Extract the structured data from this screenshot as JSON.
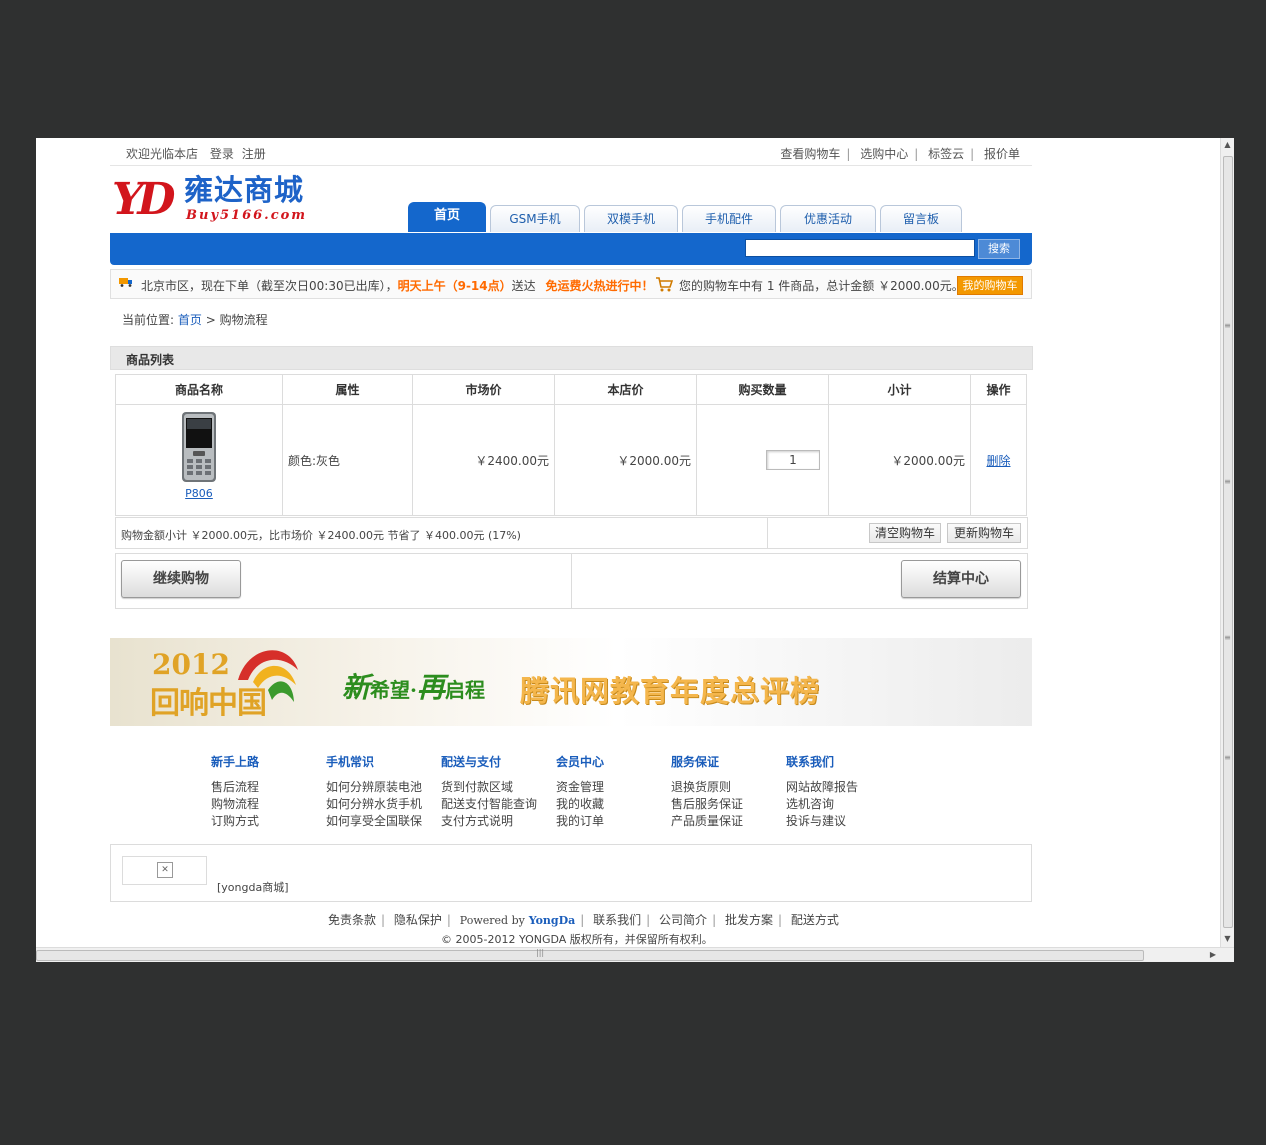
{
  "topbar": {
    "welcome": "欢迎光临本店",
    "login": "登录",
    "register": "注册",
    "links": [
      "查看购物车",
      "选购中心",
      "标签云",
      "报价单"
    ]
  },
  "logo": {
    "cn": "雍达商城",
    "mark": "YD",
    "en": "Buy5166.com"
  },
  "nav": {
    "tabs": [
      "首页",
      "GSM手机",
      "双模手机",
      "手机配件",
      "优惠活动",
      "留言板"
    ],
    "active": "首页"
  },
  "search": {
    "button": "搜索",
    "placeholder": ""
  },
  "info": {
    "delivery_prefix": "北京市区，现在下单（截至次日00:30已出库），",
    "delivery_highlight": "明天上午（9-14点）",
    "delivery_suffix": "送达",
    "promo": "免运费火热进行中！",
    "cart_summary": "您的购物车中有 1 件商品，总计金额 ￥2000.00元。",
    "my_cart": "我的购物车"
  },
  "breadcrumb": {
    "label": "当前位置:",
    "home": "首页",
    "arrow": ">",
    "current": "购物流程"
  },
  "section_title": "商品列表",
  "cart_table": {
    "headers": [
      "商品名称",
      "属性",
      "市场价",
      "本店价",
      "购买数量",
      "小计",
      "操作"
    ],
    "rows": [
      {
        "product": "P806",
        "attribute": "颜色:灰色",
        "market_price": "￥2400.00元",
        "shop_price": "￥2000.00元",
        "quantity": "1",
        "subtotal": "￥2000.00元",
        "action": "删除"
      }
    ]
  },
  "summary": {
    "text": "购物金额小计 ￥2000.00元，比市场价 ￥2400.00元 节省了 ￥400.00元 (17%)",
    "clear": "清空购物车",
    "update": "更新购物车"
  },
  "actions": {
    "continue": "继续购物",
    "checkout": "结算中心"
  },
  "banner": {
    "year": "2012",
    "country": "回响中国",
    "slogan_a": "新",
    "slogan_b": "希望·",
    "slogan_c": "再",
    "slogan_d": "启程",
    "title": "腾讯网教育年度总评榜"
  },
  "footer_columns": [
    {
      "title": "新手上路",
      "items": [
        "售后流程",
        "购物流程",
        "订购方式"
      ]
    },
    {
      "title": "手机常识",
      "items": [
        "如何分辨原装电池",
        "如何分辨水货手机",
        "如何享受全国联保"
      ]
    },
    {
      "title": "配送与支付",
      "items": [
        "货到付款区域",
        "配送支付智能查询",
        "支付方式说明"
      ]
    },
    {
      "title": "会员中心",
      "items": [
        "资金管理",
        "我的收藏",
        "我的订单"
      ]
    },
    {
      "title": "服务保证",
      "items": [
        "退换货原则",
        "售后服务保证",
        "产品质量保证"
      ]
    },
    {
      "title": "联系我们",
      "items": [
        "网站故障报告",
        "选机咨询",
        "投诉与建议"
      ]
    }
  ],
  "friend_link": {
    "name": "[yongda商城]"
  },
  "footer": {
    "links": [
      "免责条款",
      "隐私保护"
    ],
    "powered": "Powered by",
    "powered_name": "YongDa",
    "links2": [
      "联系我们",
      "公司简介",
      "批发方案",
      "配送方式"
    ],
    "copyright": "© 2005-2012 YONGDA 版权所有，并保留所有权利。"
  },
  "colors": {
    "brand_blue": "#1467cc",
    "brand_red": "#d2151c",
    "highlight_orange": "#ff6a00",
    "button_orange": "#f39800"
  }
}
